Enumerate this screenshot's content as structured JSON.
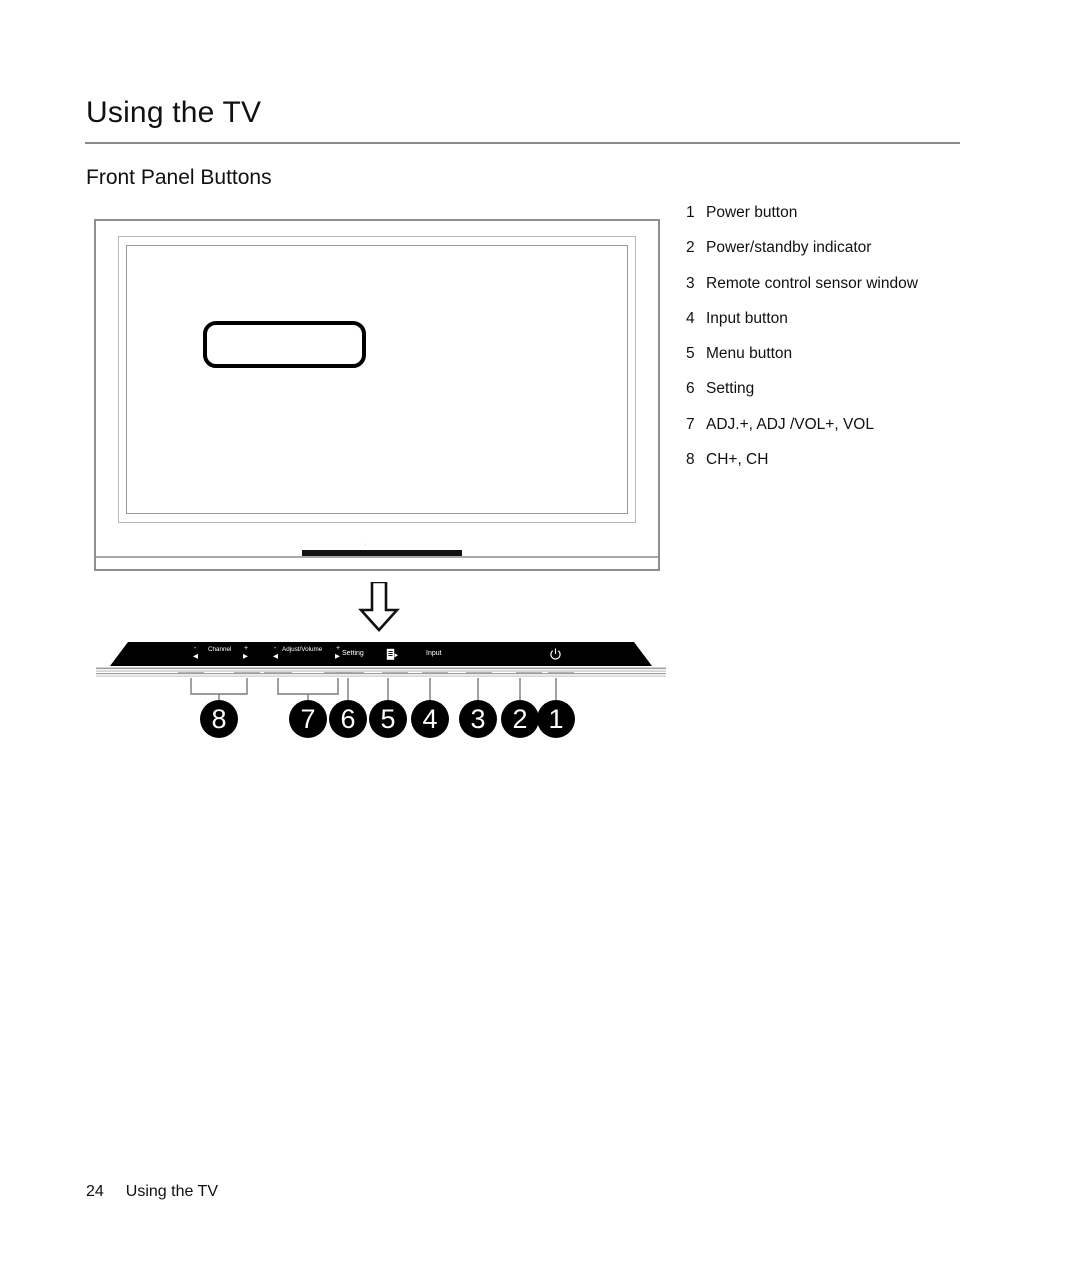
{
  "header": {
    "title": "Using the TV",
    "section_title": "Front Panel Buttons"
  },
  "legend": {
    "items": [
      {
        "num": "1",
        "label": "Power button"
      },
      {
        "num": "2",
        "label": "Power/standby indicator"
      },
      {
        "num": "3",
        "label": "Remote control sensor window"
      },
      {
        "num": "4",
        "label": "Input button"
      },
      {
        "num": "5",
        "label": "Menu button"
      },
      {
        "num": "6",
        "label": "Setting"
      },
      {
        "num": "7",
        "label": "ADJ.+, ADJ /VOL+, VOL"
      },
      {
        "num": "8",
        "label": "CH+, CH"
      }
    ]
  },
  "control_bar": {
    "channel_label": "Channel",
    "channel_minus": "-",
    "channel_plus": "+",
    "channel_left_arrow": "◀",
    "channel_right_arrow": "▶",
    "adjust_label": "Adjust/Volume",
    "adjust_minus": "-",
    "adjust_plus": "+",
    "adjust_left_arrow": "◀",
    "adjust_right_arrow": "▶",
    "setting_label": "Setting",
    "menu_icon": "menu-page-icon",
    "input_label": "Input",
    "power_icon": "⏻",
    "bar_color": "#000000",
    "label_color": "#ffffff",
    "strip_dots": "· ·"
  },
  "callouts": {
    "bullets": [
      "8",
      "7",
      "6",
      "5",
      "4",
      "3",
      "2",
      "1"
    ],
    "bullet_fill": "#000000",
    "bullet_text_color": "#ffffff"
  },
  "footer": {
    "page_number": "24",
    "page_label": "Using the TV"
  }
}
